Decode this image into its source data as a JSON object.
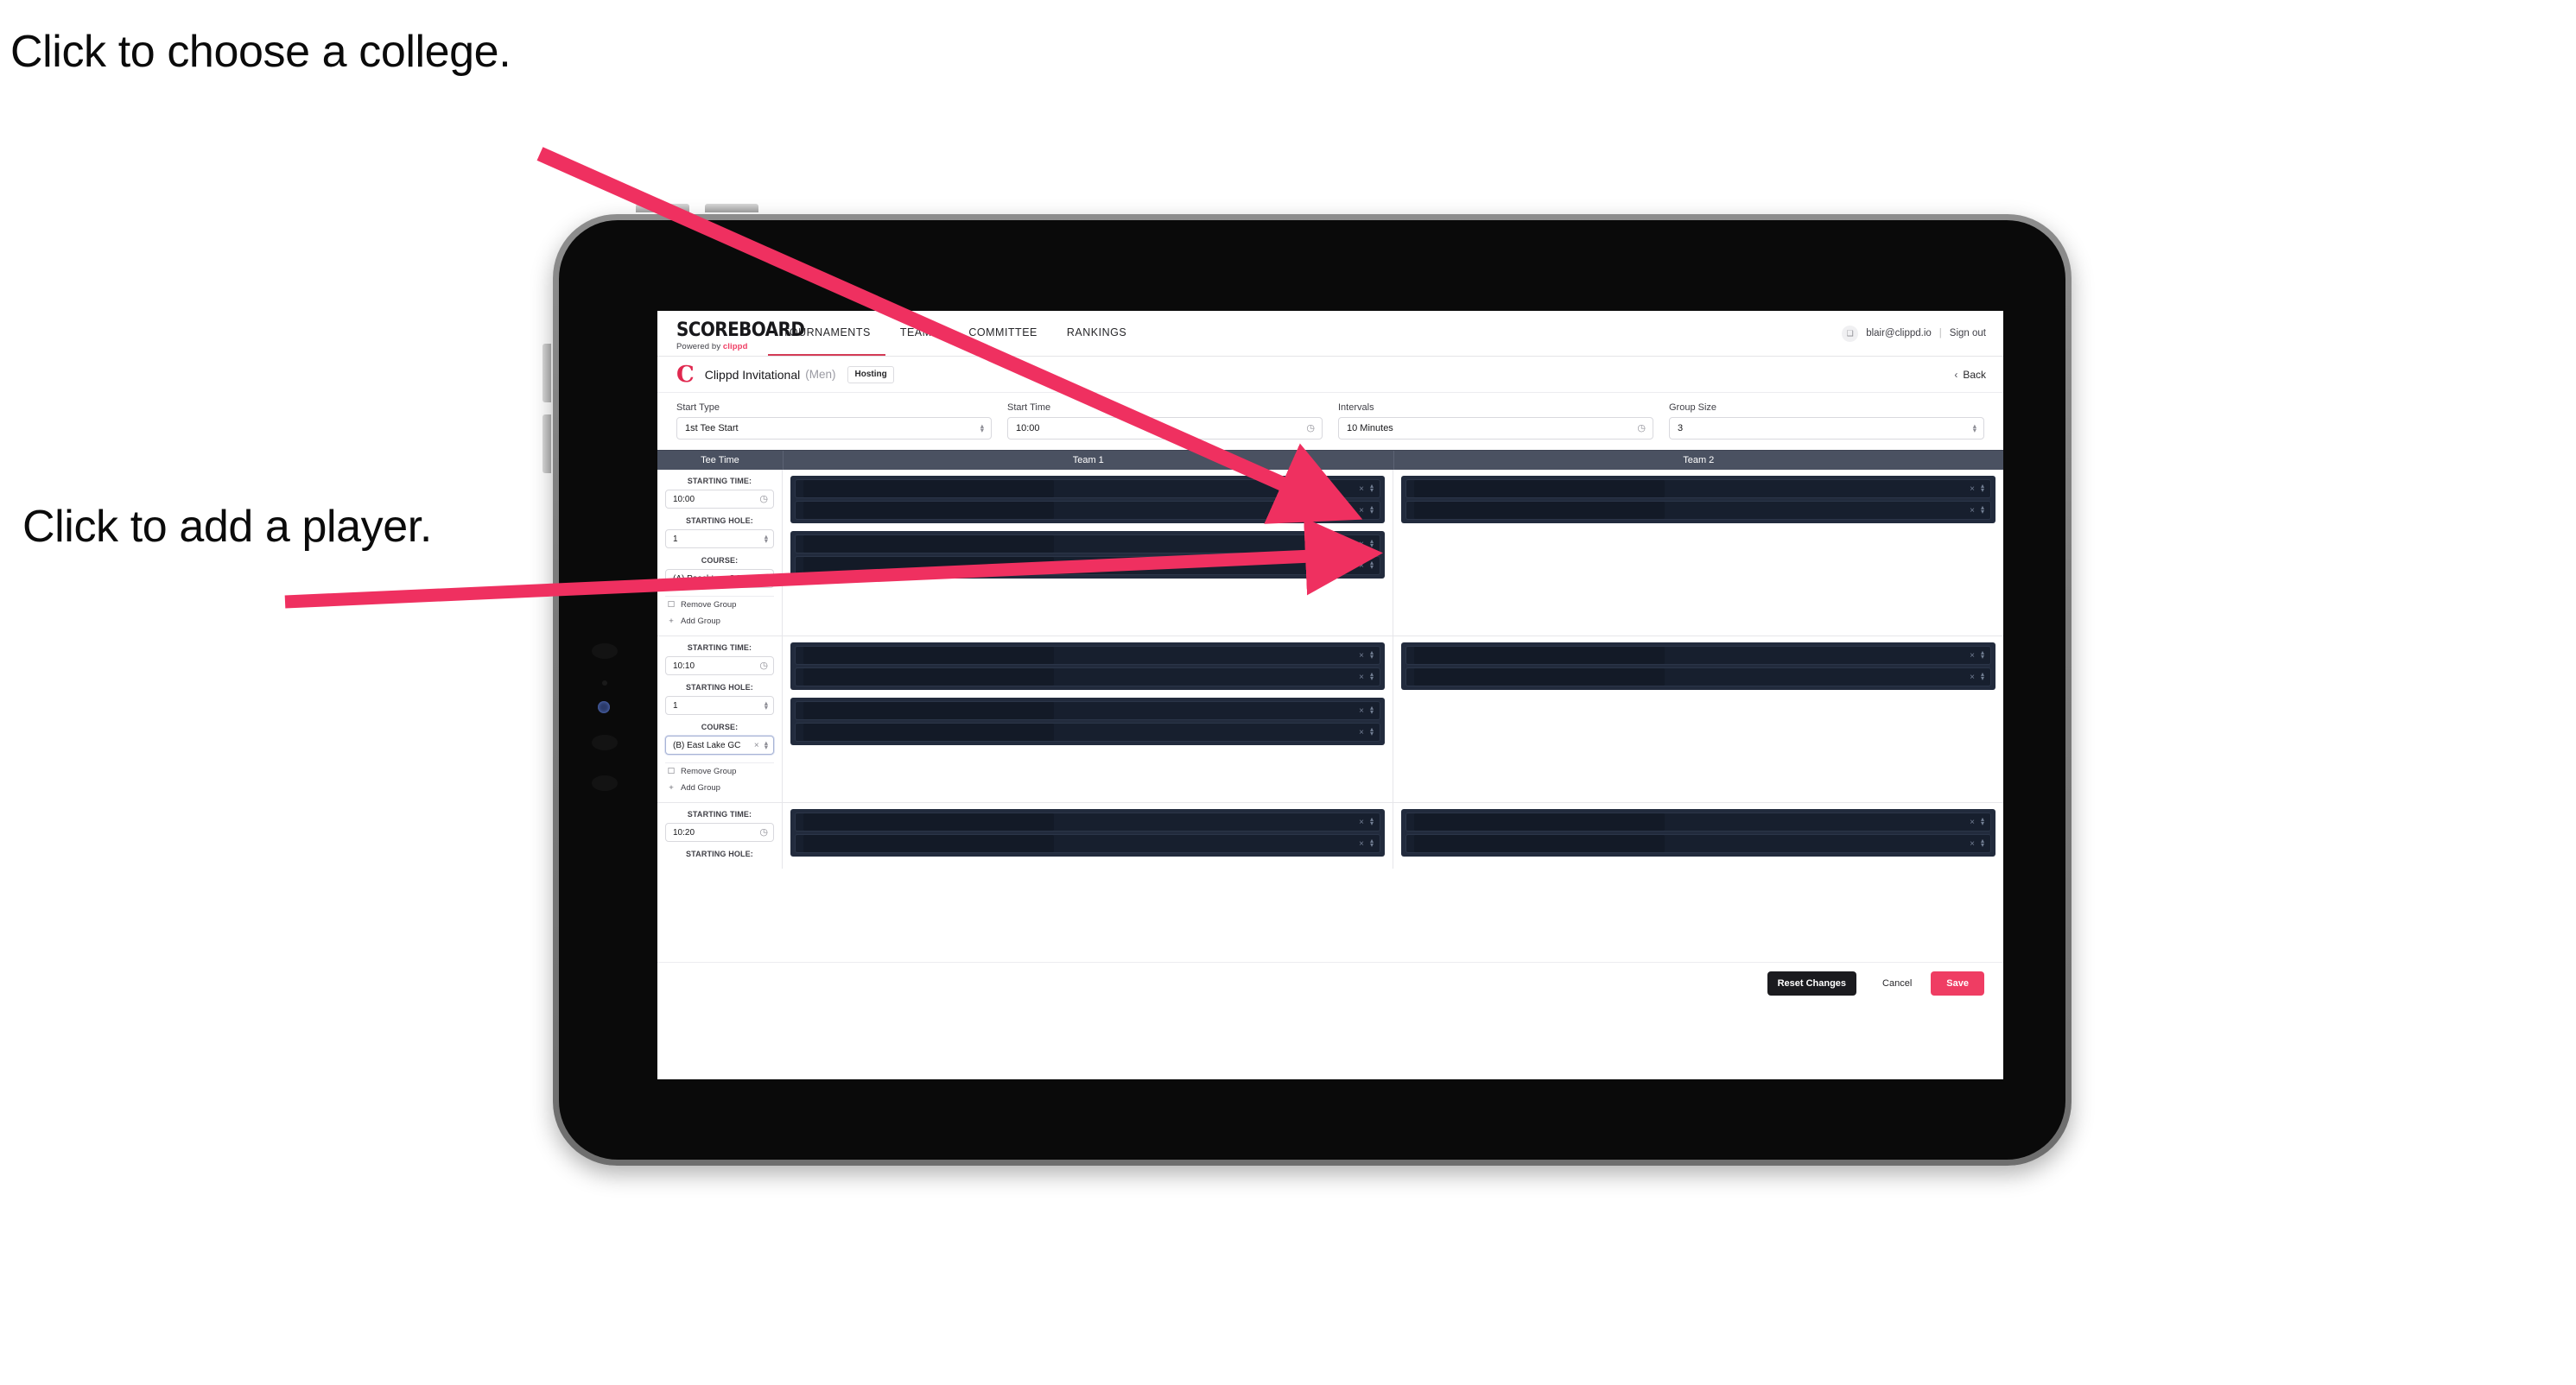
{
  "annotations": {
    "callout_college": "Click to choose a college.",
    "callout_player": "Click to add a player.",
    "arrow_color": "#ef3060"
  },
  "topnav": {
    "logo_main": "SCOREBOARD",
    "logo_sub_prefix": "Powered by ",
    "logo_sub_brand": "clippd",
    "tabs": [
      {
        "label": "TOURNAMENTS",
        "active": true
      },
      {
        "label": "TEAMS",
        "active": false
      },
      {
        "label": "COMMITTEE",
        "active": false
      },
      {
        "label": "RANKINGS",
        "active": false
      }
    ],
    "avatar_glyph": "❑",
    "user_email": "blair@clippd.io",
    "separator": "|",
    "sign_out": "Sign out"
  },
  "titlebar": {
    "brandmark": "C",
    "tournament_name": "Clippd Invitational",
    "gender": "(Men)",
    "badge": "Hosting",
    "back_chevron": "‹",
    "back_label": "Back"
  },
  "controls": [
    {
      "label": "Start Type",
      "value": "1st Tee Start",
      "icon": "spinner"
    },
    {
      "label": "Start Time",
      "value": "10:00",
      "icon": "clock"
    },
    {
      "label": "Intervals",
      "value": "10 Minutes",
      "icon": "clock"
    },
    {
      "label": "Group Size",
      "value": "3",
      "icon": "spinner"
    }
  ],
  "table": {
    "headers": [
      "Tee Time",
      "Team 1",
      "Team 2"
    ],
    "labels": {
      "starting_time": "STARTING TIME:",
      "starting_hole": "STARTING HOLE:",
      "course": "COURSE:",
      "remove_group": "Remove Group",
      "add_group": "Add Group",
      "remove_icon": "☐",
      "add_icon": "+",
      "clear_icon": "×",
      "clock_icon": "◴"
    },
    "groups": [
      {
        "starting_time": "10:00",
        "starting_hole": "1",
        "course": "(A) Peachtree GC",
        "course_focused": false,
        "team1_subgroups": [
          {
            "slots": 2
          },
          {
            "slots": 2
          }
        ],
        "team2_subgroups": [
          {
            "slots": 2
          }
        ]
      },
      {
        "starting_time": "10:10",
        "starting_hole": "1",
        "course": "(B) East Lake GC",
        "course_focused": true,
        "team1_subgroups": [
          {
            "slots": 2
          },
          {
            "slots": 2
          }
        ],
        "team2_subgroups": [
          {
            "slots": 2
          }
        ]
      },
      {
        "starting_time": "10:20",
        "starting_hole": "",
        "course": "",
        "course_focused": false,
        "team1_subgroups": [
          {
            "slots": 2
          }
        ],
        "team2_subgroups": [
          {
            "slots": 2
          }
        ],
        "partial": true
      }
    ]
  },
  "footer": {
    "reset": "Reset Changes",
    "cancel": "Cancel",
    "save": "Save",
    "save_color": "#ef3d63"
  }
}
